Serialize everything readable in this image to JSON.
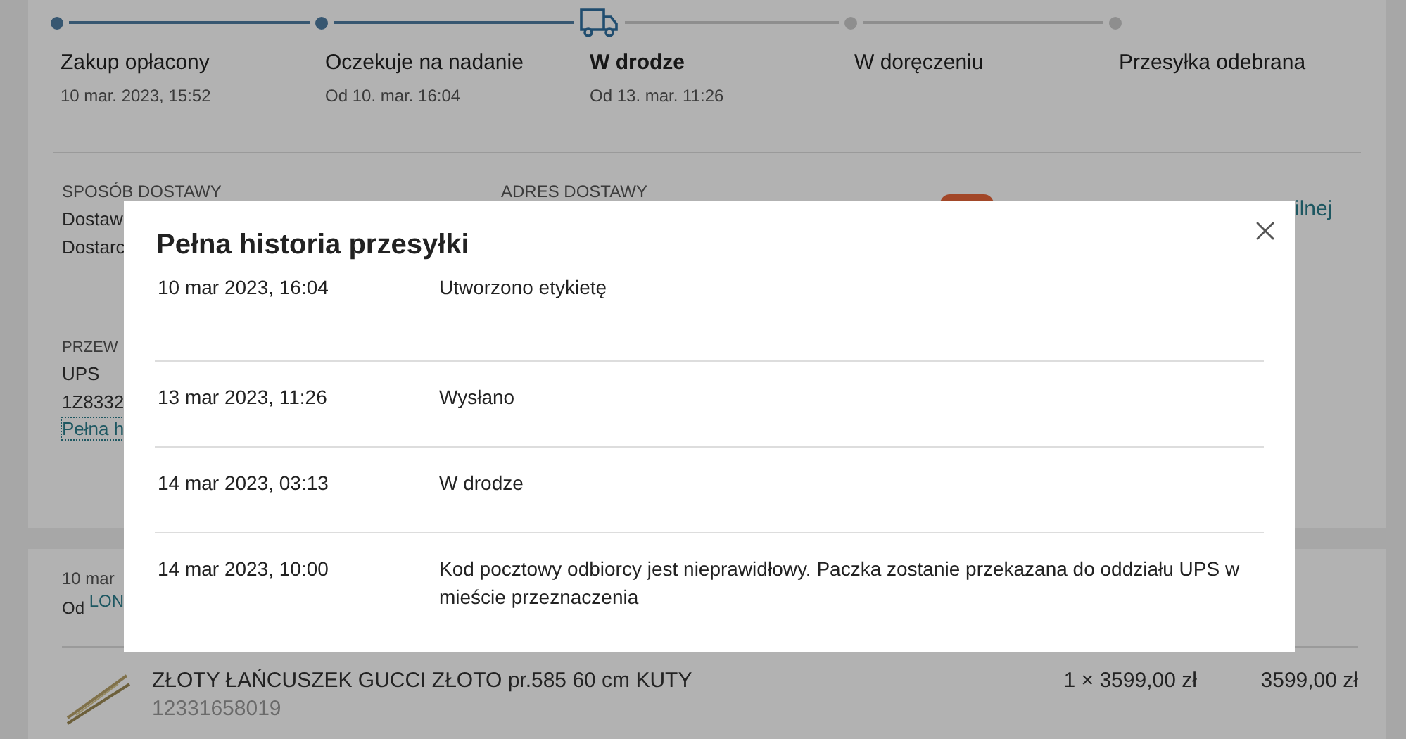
{
  "stepper": {
    "steps": [
      {
        "label": "Zakup opłacony",
        "date": "10 mar. 2023, 15:52",
        "completed": true,
        "active": false
      },
      {
        "label": "Oczekuje na nadanie",
        "date": "Od 10. mar. 16:04",
        "completed": true,
        "active": false
      },
      {
        "label": "W drodze",
        "date": "Od 13. mar. 11:26",
        "completed": false,
        "active": true
      },
      {
        "label": "W doręczeniu",
        "completed": false,
        "active": false
      },
      {
        "label": "Przesyłka odebrana",
        "completed": false,
        "active": false
      }
    ]
  },
  "delivery": {
    "method_label": "SPOSÓB DOSTAWY",
    "method_lines": [
      "Dostaw",
      "Dostarc"
    ],
    "address_label": "ADRES DOSTAWY",
    "note": "ilnej",
    "carrier_label": "PRZEW",
    "carrier": "UPS",
    "tracking": "1Z8332",
    "history_link": "Pełna h"
  },
  "order": {
    "date": "10 mar",
    "from": "Od",
    "seller": "LON",
    "item": {
      "kind": "picture",
      "name": "ZŁOTY ŁAŃCUSZEK GUCCI ZŁOTO pr.585 60 cm KUTY",
      "id": "12331658019",
      "quantity": "1 × 3599,00 zł",
      "total": "3599,00 zł"
    }
  },
  "modal": {
    "title": "Pełna historia przesyłki",
    "events": [
      {
        "time": "10 mar 2023, 16:04",
        "text": "Utworzono etykietę"
      },
      {
        "time": "13 mar 2023, 11:26",
        "text": "Wysłano"
      },
      {
        "time": "14 mar 2023, 03:13",
        "text": "W drodze"
      },
      {
        "time": "14 mar 2023, 10:00",
        "text": "Kod pocztowy odbiorcy jest nieprawidłowy. Paczka zostanie przekazana do oddziału UPS w mieście przeznaczenia"
      }
    ]
  }
}
